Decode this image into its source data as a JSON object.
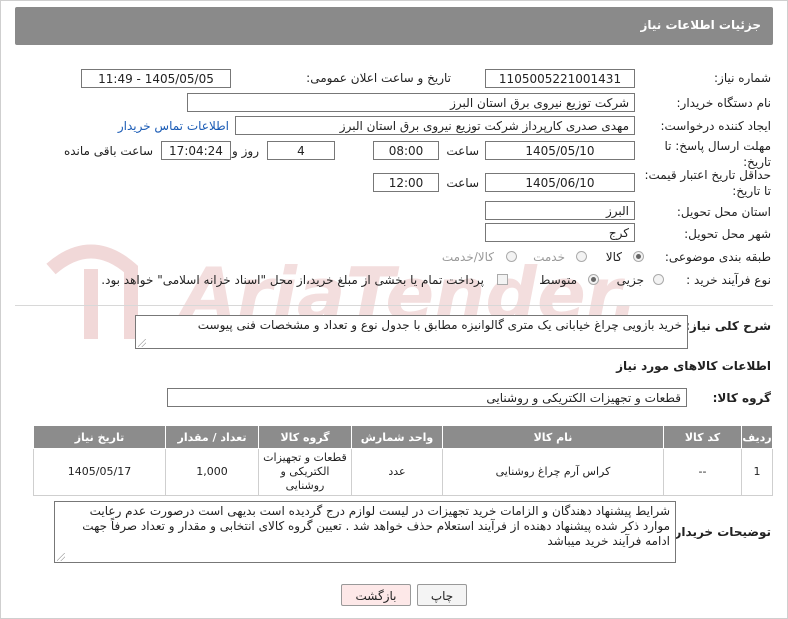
{
  "header": {
    "title": "جزئیات اطلاعات نیاز"
  },
  "fields": {
    "need_number_label": "شماره نیاز:",
    "need_number": "1105005221001431",
    "announce_label": "تاریخ و ساعت اعلان عمومی:",
    "announce_value": "1405/05/05 - 11:49",
    "buyer_org_label": "نام دستگاه خریدار:",
    "buyer_org": "شرکت توزیع نیروی برق استان البرز",
    "creator_label": "ایجاد کننده درخواست:",
    "creator": "مهدی صدری کارپرداز شرکت توزیع نیروی برق استان البرز",
    "contact_link": "اطلاعات تماس خریدار",
    "deadline_label": "مهلت ارسال پاسخ: تا تاریخ:",
    "deadline_date": "1405/05/10",
    "time_label": "ساعت",
    "deadline_time": "08:00",
    "days_value": "4",
    "days_label": "روز و",
    "remaining_time": "17:04:24",
    "remaining_label": "ساعت باقی مانده",
    "validity_label": "حداقل تاریخ اعتبار قیمت: تا تاریخ:",
    "validity_date": "1405/06/10",
    "validity_time": "12:00",
    "province_label": "استان محل تحویل:",
    "province": "البرز",
    "city_label": "شهر محل تحویل:",
    "city": "کرج",
    "category_label": "طبقه بندی موضوعی:",
    "category_options": [
      "کالا",
      "خدمت",
      "کالا/خدمت"
    ],
    "process_label": "نوع فرآیند خرید :",
    "process_options": [
      "جزیی",
      "متوسط"
    ],
    "payment_note": "پرداخت تمام یا بخشی از مبلغ خرید،از محل \"اسناد خزانه اسلامی\" خواهد بود."
  },
  "summary": {
    "label": "شرح کلی نیاز:",
    "text": "خرید بازویی چراغ خیابانی یک متری گالوانیزه مطابق با جدول نوع و تعداد و مشخصات فنی پیوست"
  },
  "goods": {
    "section_title": "اطلاعات کالاهای مورد نیاز",
    "group_label": "گروه کالا:",
    "group_value": "قطعات و تجهیزات الکتریکی و روشنایی",
    "columns": [
      "ردیف",
      "کد کالا",
      "نام کالا",
      "واحد شمارش",
      "گروه کالا",
      "تعداد / مقدار",
      "تاریخ نیاز"
    ],
    "rows": [
      {
        "row": "1",
        "code": "--",
        "name": "کراس آرم چراغ روشنایی",
        "unit": "عدد",
        "group": "قطعات و تجهیزات الکتریکی و روشنایی",
        "qty": "1,000",
        "date": "1405/05/17"
      }
    ]
  },
  "notes": {
    "label": "توضیحات خریدار:",
    "text": "شرایط پیشنهاد دهندگان و الزامات خرید تجهیزات در لیست لوازم درج گردیده است بدیهی است درصورت عدم رعایت موارد ذکر شده پیشنهاد دهنده از فرآیند استعلام حذف خواهد شد . تعیین گروه کالای انتخابی و مقدار و تعداد صرفاً جهت ادامه فرآیند خرید میباشد"
  },
  "buttons": {
    "print": "چاپ",
    "back": "بازگشت"
  },
  "watermark": "AriaTender.net",
  "colors": {
    "header": "#8a8a8a",
    "link": "#1a5bb5",
    "back_button": "#fde8e8",
    "watermark": "#f1d8d8"
  }
}
